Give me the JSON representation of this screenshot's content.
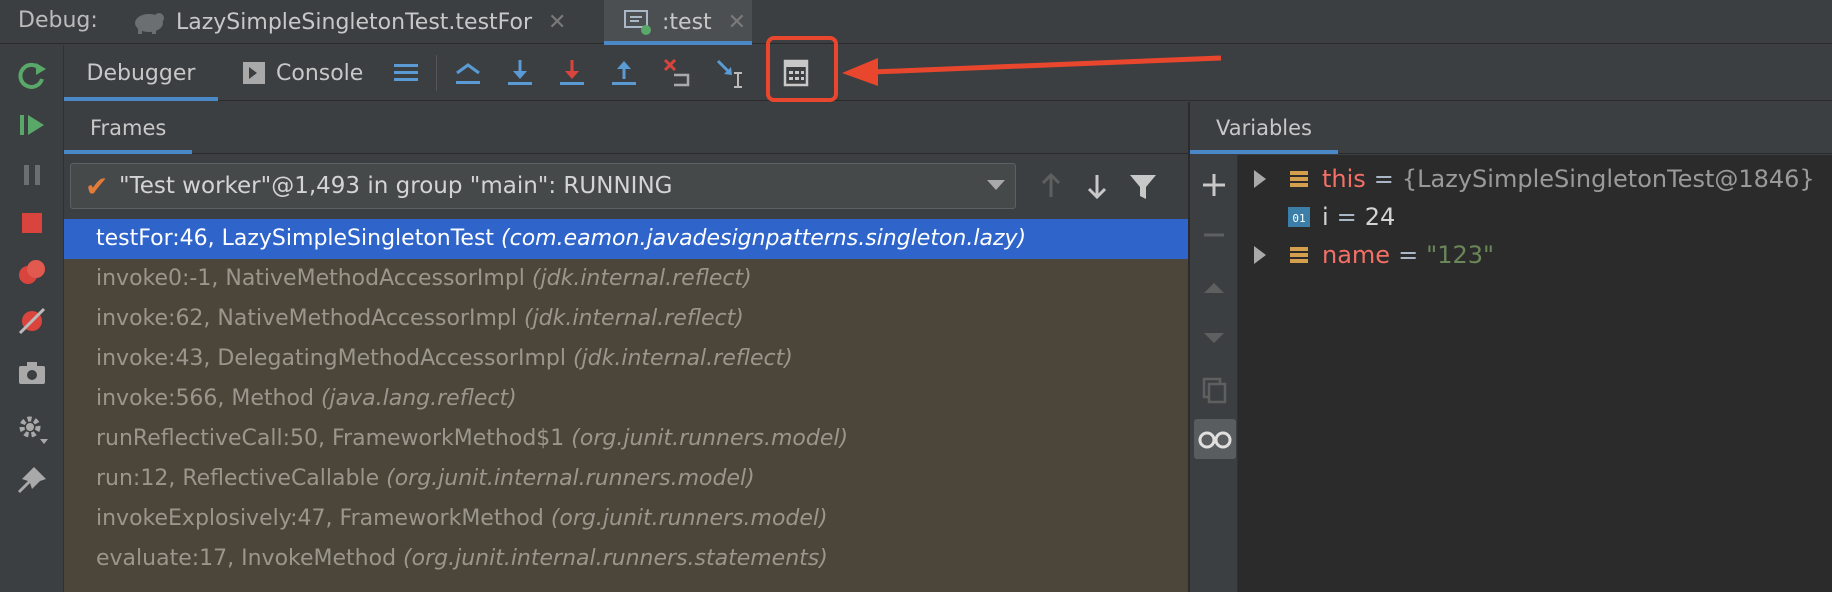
{
  "debug_bar": {
    "label": "Debug:",
    "tabs": [
      {
        "label": "LazySimpleSingletonTest.testFor",
        "close": "✕"
      },
      {
        "label": ":test",
        "close": "✕"
      }
    ]
  },
  "toolbar": {
    "debugger_tab": "Debugger",
    "console_tab": "Console"
  },
  "frames": {
    "tab_label": "Frames",
    "thread": "\"Test worker\"@1,493 in group \"main\": RUNNING",
    "items": [
      {
        "method": "testFor:46, LazySimpleSingletonTest",
        "pkg": "(com.eamon.javadesignpatterns.singleton.lazy)"
      },
      {
        "method": "invoke0:-1, NativeMethodAccessorImpl",
        "pkg": "(jdk.internal.reflect)"
      },
      {
        "method": "invoke:62, NativeMethodAccessorImpl",
        "pkg": "(jdk.internal.reflect)"
      },
      {
        "method": "invoke:43, DelegatingMethodAccessorImpl",
        "pkg": "(jdk.internal.reflect)"
      },
      {
        "method": "invoke:566, Method",
        "pkg": "(java.lang.reflect)"
      },
      {
        "method": "runReflectiveCall:50, FrameworkMethod$1",
        "pkg": "(org.junit.runners.model)"
      },
      {
        "method": "run:12, ReflectiveCallable",
        "pkg": "(org.junit.internal.runners.model)"
      },
      {
        "method": "invokeExplosively:47, FrameworkMethod",
        "pkg": "(org.junit.runners.model)"
      },
      {
        "method": "evaluate:17, InvokeMethod",
        "pkg": "(org.junit.internal.runners.statements)"
      }
    ]
  },
  "variables": {
    "tab_label": "Variables",
    "items": [
      {
        "name": "this",
        "eq": "=",
        "value": "{LazySimpleSingletonTest@1846}"
      },
      {
        "name": "i",
        "eq": "=",
        "value": "24",
        "icon_text": "01"
      },
      {
        "name": "name",
        "eq": "=",
        "value": "\"123\""
      }
    ]
  },
  "colors": {
    "accent": "#4a88c7",
    "selection": "#2f65ca",
    "annotation": "#e8472d"
  }
}
